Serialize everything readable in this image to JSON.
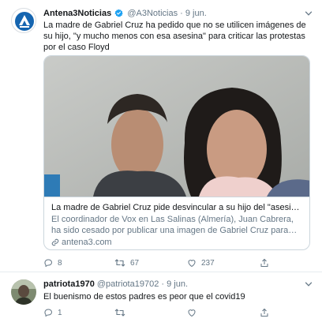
{
  "tweet1": {
    "author_name": "Antena3Noticias",
    "handle": "@A3Noticias",
    "separator": "·",
    "time": "9 jun.",
    "text": "La madre de Gabriel Cruz ha pedido que no se utilicen imágenes de su hijo, \"y mucho menos con esa asesina\" para criticar las protestas por el caso Floyd",
    "card": {
      "title": "La madre de Gabriel Cruz pide desvincular a su hijo del \"asesinato ra...",
      "description": "El coordinador de Vox en Las Salinas (Almería), Juan Cabrera, ha sido cesado por publicar una imagen de Gabriel Cruz para criticar las ...",
      "domain": "antena3.com"
    },
    "actions": {
      "replies": "8",
      "retweets": "67",
      "likes": "237"
    }
  },
  "tweet2": {
    "author_name": "patriota1970",
    "handle": "@patriota19702",
    "separator": "·",
    "time": "9 jun.",
    "text": "El buenismo de estos padres es peor que el covid19",
    "actions": {
      "replies": "1",
      "retweets": "",
      "likes": ""
    }
  },
  "icons": {
    "verified": "verified-badge-icon",
    "caret": "chevron-down-icon",
    "reply": "reply-icon",
    "retweet": "retweet-icon",
    "like": "heart-icon",
    "share": "share-icon",
    "link": "link-icon"
  },
  "colors": {
    "brand_blue": "#1da1f2",
    "text": "#14171a",
    "secondary": "#657786",
    "border": "#e6ecf0",
    "a3_logo": "#1565b0"
  }
}
